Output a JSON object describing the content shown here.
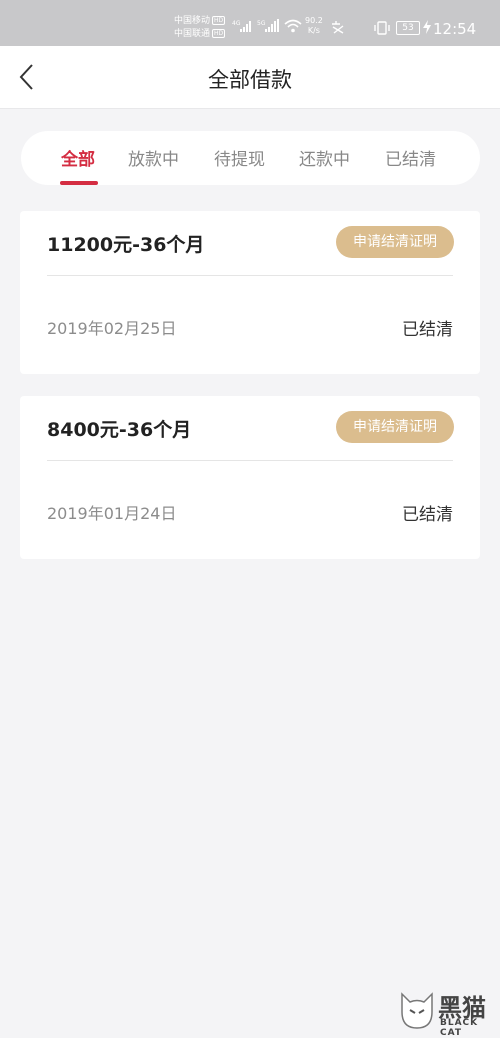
{
  "status_bar": {
    "carrier_1": "中国移动",
    "carrier_2": "中国联通",
    "hd_label": "HD",
    "net_1": "4G",
    "net_2": "5G",
    "speed_value": "90.2",
    "speed_unit": "K/s",
    "battery": "53",
    "time": "12:54"
  },
  "navbar": {
    "title": "全部借款"
  },
  "tabs": [
    {
      "label": "全部",
      "active": true
    },
    {
      "label": "放款中",
      "active": false
    },
    {
      "label": "待提现",
      "active": false
    },
    {
      "label": "还款中",
      "active": false
    },
    {
      "label": "已结清",
      "active": false
    }
  ],
  "loans": [
    {
      "title": "11200元-36个月",
      "action_label": "申请结清证明",
      "date": "2019年02月25日",
      "status": "已结清"
    },
    {
      "title": "8400元-36个月",
      "action_label": "申请结清证明",
      "date": "2019年01月24日",
      "status": "已结清"
    }
  ],
  "watermark": {
    "brand": "黑猫",
    "brand_en": "BLACK CAT"
  },
  "colors": {
    "accent": "#d42d42",
    "button_gold": "#dbbd8e",
    "background": "#f4f4f6"
  }
}
